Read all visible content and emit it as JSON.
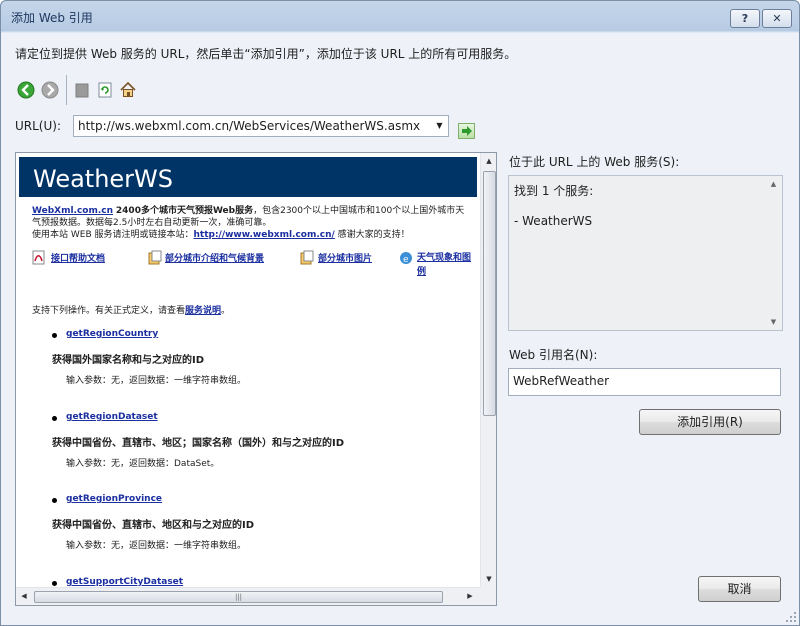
{
  "window": {
    "title": "添加 Web 引用",
    "help_label": "?",
    "close_label": "✕"
  },
  "instruction": "请定位到提供 Web 服务的 URL，然后单击“添加引用”，添加位于该 URL 上的所有可用服务。",
  "toolbar": {
    "back_icon": "back-arrow-icon",
    "forward_icon": "forward-arrow-icon",
    "stop_icon": "stop-icon",
    "refresh_icon": "refresh-icon",
    "home_icon": "home-icon"
  },
  "url": {
    "label": "URL(U):",
    "value": "http://ws.webxml.com.cn/WebServices/WeatherWS.asmx",
    "go_icon": "go-arrow-icon"
  },
  "browser": {
    "page_title": "WeatherWS",
    "intro_link": "WebXml.com.cn",
    "intro_bold": "2400多个城市天气预报Web服务",
    "intro_text": "，包含2300个以上中国城市和100个以上国外城市天气预报数据。数据每2.5小时左右自动更新一次，准确可靠。",
    "intro_line2_prefix": "使用本站 WEB 服务请注明或链接本站：",
    "intro_line2_link": "http://www.webxml.com.cn/",
    "intro_line2_suffix": " 感谢大家的支持！",
    "doc_links": [
      "接口帮助文档",
      "部分城市介绍和气候背景",
      "部分城市图片",
      "天气现象和图例"
    ],
    "support_prefix": "支持下列操作。有关正式定义，请查看",
    "support_link": "服务说明",
    "support_suffix": "。",
    "operations": [
      {
        "name": "getRegionCountry",
        "desc": "获得国外国家名称和与之对应的ID",
        "params": "输入参数：无，返回数据：一维字符串数组。"
      },
      {
        "name": "getRegionDataset",
        "desc": "获得中国省份、直辖市、地区；国家名称（国外）和与之对应的ID",
        "params": "输入参数：无，返回数据：DataSet。"
      },
      {
        "name": "getRegionProvince",
        "desc": "获得中国省份、直辖市、地区和与之对应的ID",
        "params": "输入参数：无，返回数据：一维字符串数组。"
      },
      {
        "name": "getSupportCityDataset",
        "desc": "",
        "params": ""
      }
    ]
  },
  "services": {
    "label": "位于此 URL 上的 Web 服务(S):",
    "found_text": "找到 1 个服务:",
    "items": [
      "- WeatherWS"
    ]
  },
  "reference_name": {
    "label": "Web 引用名(N):",
    "value": "WebRefWeather"
  },
  "buttons": {
    "add_reference": "添加引用(R)",
    "cancel": "取消"
  }
}
